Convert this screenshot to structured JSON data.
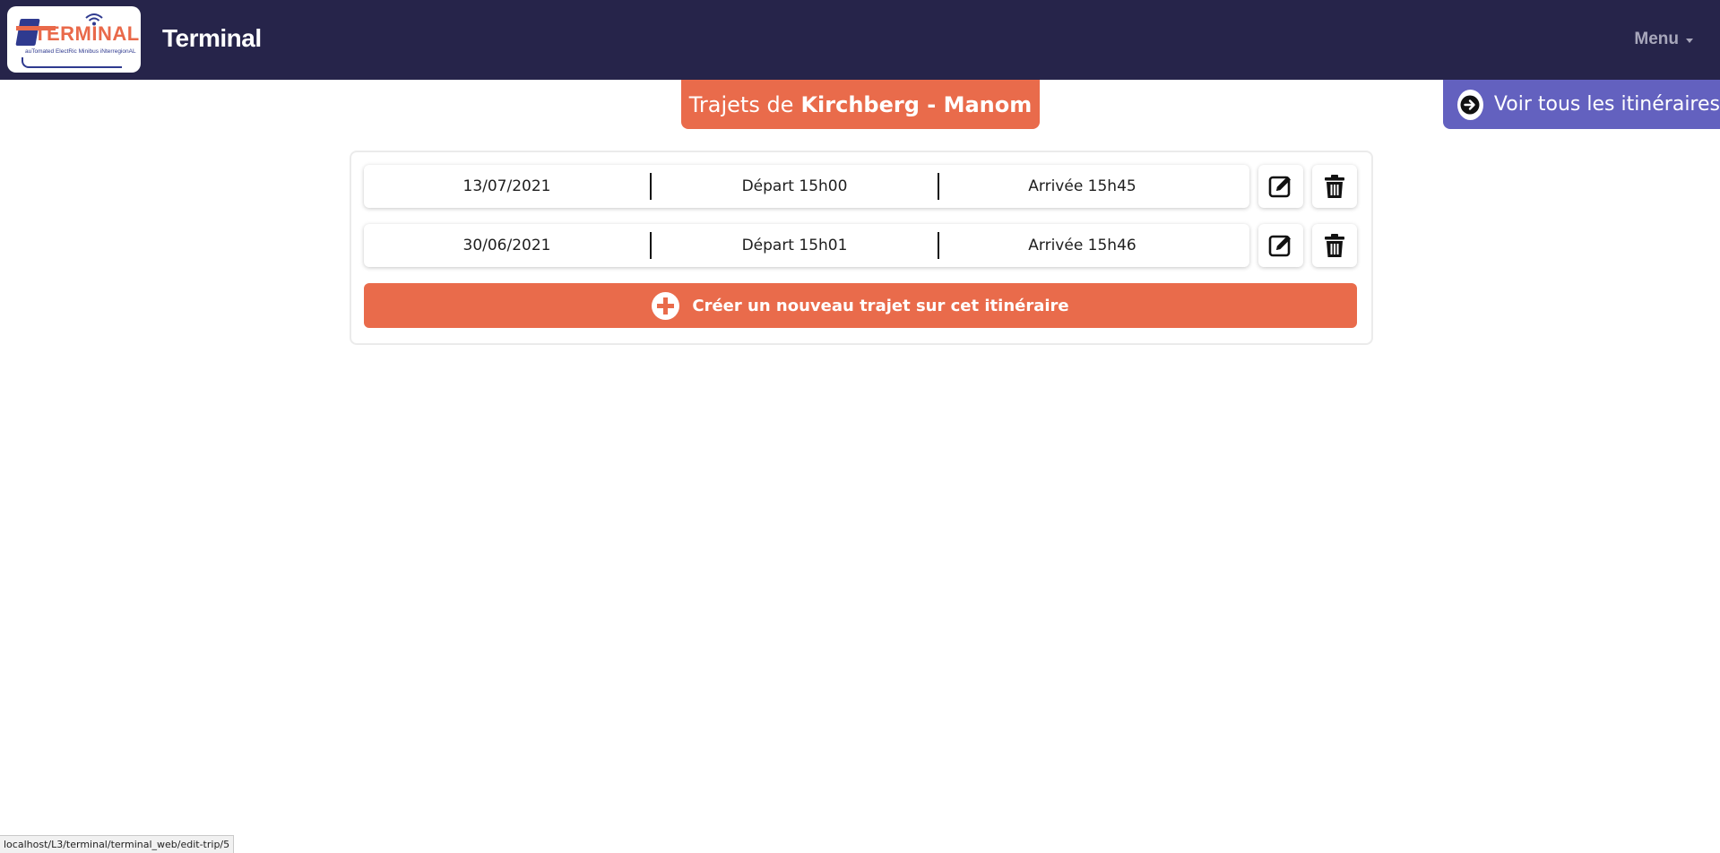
{
  "header": {
    "logo_word": "TERMINAL",
    "logo_tagline": "auTomated ElectRic Minibus iNterregionAL",
    "app_title": "Terminal",
    "menu_label": "Menu"
  },
  "title": {
    "prefix": "Trajets de",
    "route": "Kirchberg - Manom"
  },
  "all_routes_label": "Voir tous les itinéraires",
  "trips": [
    {
      "date": "13/07/2021",
      "departure": "Départ 15h00",
      "arrival": "Arrivée 15h45"
    },
    {
      "date": "30/06/2021",
      "departure": "Départ 15h01",
      "arrival": "Arrivée 15h46"
    }
  ],
  "create_label": "Créer un nouveau trajet sur cet itinéraire",
  "status_url": "localhost/L3/terminal/terminal_web/edit-trip/5",
  "icons": {
    "edit": "pencil-square-icon",
    "delete": "trash-icon",
    "go": "arrow-right-circle-icon",
    "add": "plus-circle-icon"
  },
  "colors": {
    "navbar": "#26244a",
    "accent_orange": "#e96b4b",
    "accent_purple": "#6361bf"
  }
}
